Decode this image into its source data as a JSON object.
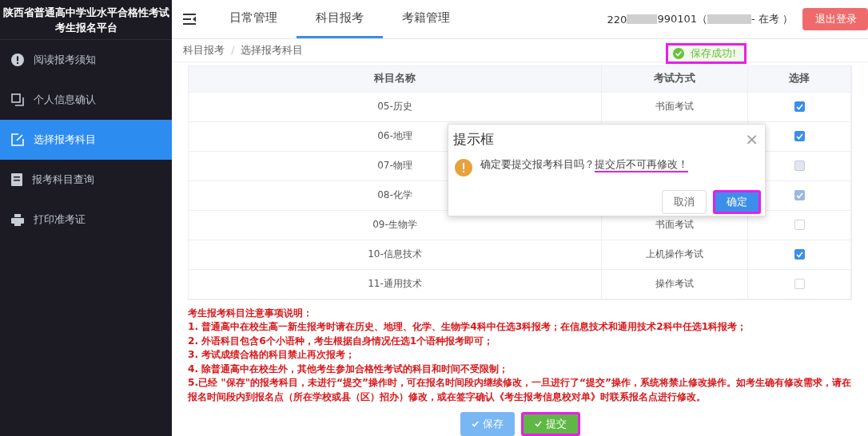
{
  "sidebar": {
    "title_lines": [
      "陕西省普通高中学业水平合格性考试",
      "考生报名平台"
    ],
    "items": [
      {
        "label": "阅读报考须知",
        "selected": false
      },
      {
        "label": "个人信息确认",
        "selected": false
      },
      {
        "label": "选择报考科目",
        "selected": true
      },
      {
        "label": "报考科目查询",
        "selected": false
      },
      {
        "label": "打印准考证",
        "selected": false
      }
    ]
  },
  "topbar": {
    "tabs": [
      {
        "label": "日常管理",
        "selected": false
      },
      {
        "label": "科目报考",
        "selected": true
      },
      {
        "label": "考籍管理",
        "selected": false
      }
    ],
    "user": {
      "id_prefix": "220",
      "id_suffix": "990101（",
      "status": " - 在考 ）"
    },
    "logout": "退出登录"
  },
  "breadcrumb": {
    "items": [
      "科目报考",
      "选择报考科目"
    ],
    "separator": "/"
  },
  "toast": {
    "text": "保存成功!",
    "highlighted": true
  },
  "table": {
    "columns": [
      "科目名称",
      "考试方式",
      "选择"
    ],
    "rows": [
      {
        "name": "05-历史",
        "method": "书面考试",
        "checked": true,
        "disabled": false
      },
      {
        "name": "06-地理",
        "checked": true,
        "disabled": false
      },
      {
        "name": "07-物理",
        "checked": false,
        "disabled": true
      },
      {
        "name": "08-化学",
        "checked": true,
        "disabled": true
      },
      {
        "name": "09-生物学",
        "method": "书面考试",
        "checked": false,
        "disabled": false
      },
      {
        "name": "10-信息技术",
        "method": "上机操作考试",
        "checked": true,
        "disabled": false
      },
      {
        "name": "11-通用技术",
        "method": "操作考试",
        "checked": false,
        "disabled": false
      }
    ]
  },
  "notes": [
    "考生报考科目注意事项说明：",
    "1. 普通高中在校生高一新生报考时请在历史、地理、化学、生物学4科中任选3科报考；在信息技术和通用技术2科中任选1科报考；",
    "2. 外语科目包含6个小语种，考生根据自身情况任选1个语种报考即可；",
    "3. 考试成绩合格的科目禁止再次报考；",
    "4. 除普通高中在校生外，其他考生参加合格性考试的科目和时间不受限制；",
    "5.已经 \"保存\"的报考科目，未进行“提交”操作时，可在报名时间段内继续修改，一旦进行了“提交”操作，系统将禁止修改操作。如考生确有修改需求，请在报名时间段内到报名点（所在学校或县（区）招办）修改，或在签字确认《考生报考信息校对单》时联系报名点进行修改。"
  ],
  "buttons": [
    {
      "label": "保存",
      "kind": "save",
      "highlighted": false
    },
    {
      "label": "提交",
      "kind": "submit",
      "highlighted": true
    }
  ],
  "dialog": {
    "title": "提示框",
    "close": "×",
    "message": "确定要提交报考科目吗？",
    "emphasis": {
      "text": "提交后不可再修改！",
      "underlined": true
    },
    "buttons": [
      {
        "label": "取消",
        "kind": "cancel",
        "highlighted": false
      },
      {
        "label": "确定",
        "kind": "confirm",
        "highlighted": true
      }
    ]
  }
}
